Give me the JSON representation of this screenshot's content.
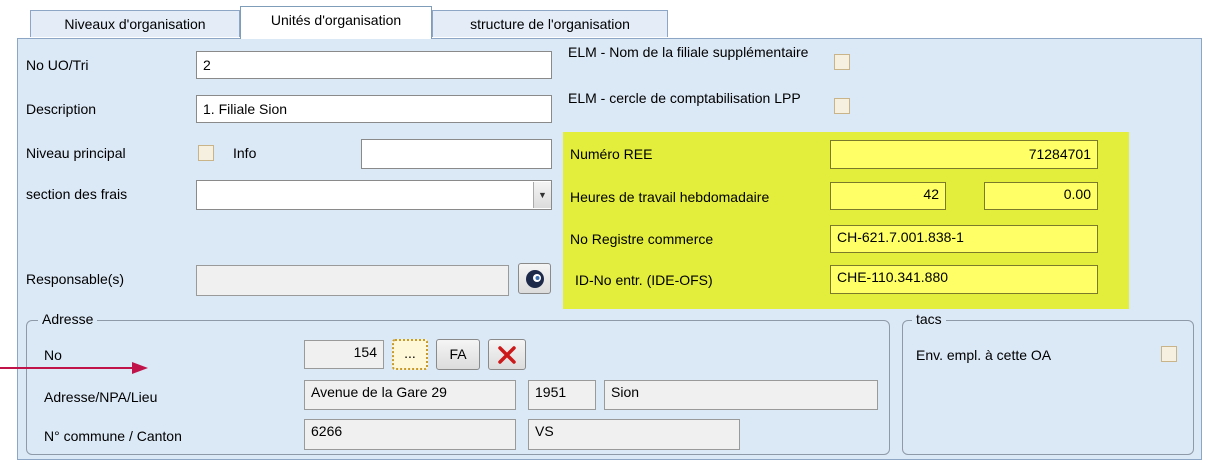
{
  "tabs": [
    {
      "label": "Niveaux d'organisation"
    },
    {
      "label": "Unités d'organisation"
    },
    {
      "label": "structure de l'organisation"
    }
  ],
  "form": {
    "no_uo_label": "No UO/Tri",
    "no_uo_value": "2",
    "description_label": "Description",
    "description_value": "1. Filiale Sion",
    "niveau_label": "Niveau principal",
    "info_label": "Info",
    "info_value": "",
    "section_label": "section des frais",
    "section_value": "",
    "responsable_label": "Responsable(s)",
    "responsable_value": ""
  },
  "elm": {
    "nom_filiale_label": "ELM - Nom de la filiale supplémentaire",
    "cercle_label": "ELM - cercle de comptabilisation LPP"
  },
  "registry": {
    "ree_label": "Numéro REE",
    "ree_value": "71284701",
    "heures_label": "Heures de travail hebdomadaire",
    "heures_value": "42",
    "heures_decimal": "0.00",
    "registre_label": "No Registre commerce",
    "registre_value": "CH-621.7.001.838-1",
    "ide_label": "ID-No entr. (IDE-OFS)",
    "ide_value": "CHE-110.341.880"
  },
  "adresse": {
    "title": "Adresse",
    "no_label": "No",
    "no_value": "154",
    "ellipsis_label": "...",
    "fa_label": "FA",
    "adresse_label": "Adresse/NPA/Lieu",
    "street_value": "Avenue de la Gare 29",
    "npa_value": "1951",
    "lieu_value": "Sion",
    "commune_label": "N° commune / Canton",
    "commune_value": "6266",
    "canton_value": "VS"
  },
  "tacs": {
    "title": "tacs",
    "env_label": "Env. empl. à cette OA"
  },
  "colors": {
    "panel_bg": "#dbe8f6",
    "highlight": "#e3ee3c",
    "yellow_field": "#ffff66",
    "arrow": "#c0134a",
    "delete_red": "#cc1a1a"
  },
  "icons": {
    "dropdown": "chevron-down-icon",
    "lookup": "lookup-eye-icon",
    "delete": "delete-x-icon",
    "arrow": "arrow-right-icon"
  }
}
